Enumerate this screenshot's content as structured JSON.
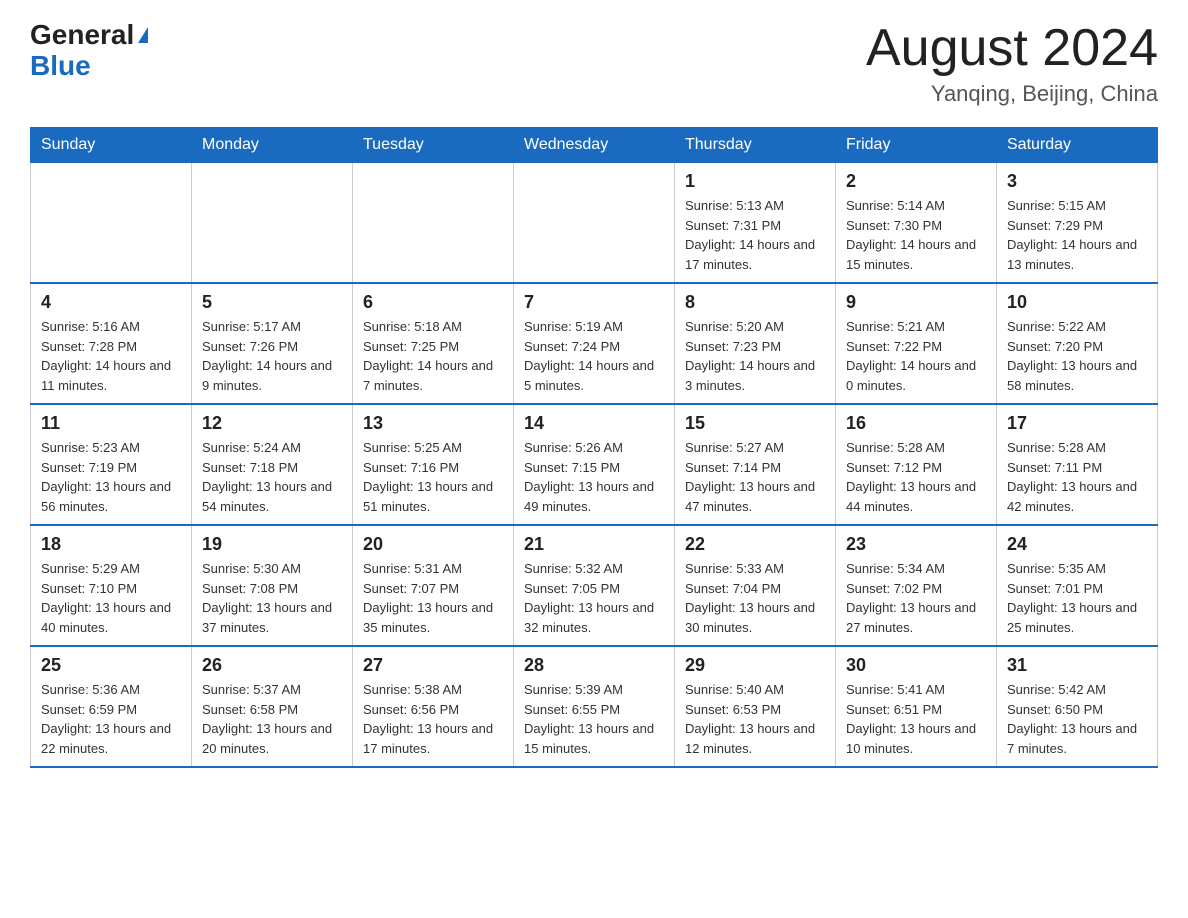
{
  "header": {
    "logo_general": "General",
    "logo_blue": "Blue",
    "title": "August 2024",
    "subtitle": "Yanqing, Beijing, China"
  },
  "weekdays": [
    "Sunday",
    "Monday",
    "Tuesday",
    "Wednesday",
    "Thursday",
    "Friday",
    "Saturday"
  ],
  "weeks": [
    [
      {
        "num": "",
        "info": ""
      },
      {
        "num": "",
        "info": ""
      },
      {
        "num": "",
        "info": ""
      },
      {
        "num": "",
        "info": ""
      },
      {
        "num": "1",
        "info": "Sunrise: 5:13 AM\nSunset: 7:31 PM\nDaylight: 14 hours and 17 minutes."
      },
      {
        "num": "2",
        "info": "Sunrise: 5:14 AM\nSunset: 7:30 PM\nDaylight: 14 hours and 15 minutes."
      },
      {
        "num": "3",
        "info": "Sunrise: 5:15 AM\nSunset: 7:29 PM\nDaylight: 14 hours and 13 minutes."
      }
    ],
    [
      {
        "num": "4",
        "info": "Sunrise: 5:16 AM\nSunset: 7:28 PM\nDaylight: 14 hours and 11 minutes."
      },
      {
        "num": "5",
        "info": "Sunrise: 5:17 AM\nSunset: 7:26 PM\nDaylight: 14 hours and 9 minutes."
      },
      {
        "num": "6",
        "info": "Sunrise: 5:18 AM\nSunset: 7:25 PM\nDaylight: 14 hours and 7 minutes."
      },
      {
        "num": "7",
        "info": "Sunrise: 5:19 AM\nSunset: 7:24 PM\nDaylight: 14 hours and 5 minutes."
      },
      {
        "num": "8",
        "info": "Sunrise: 5:20 AM\nSunset: 7:23 PM\nDaylight: 14 hours and 3 minutes."
      },
      {
        "num": "9",
        "info": "Sunrise: 5:21 AM\nSunset: 7:22 PM\nDaylight: 14 hours and 0 minutes."
      },
      {
        "num": "10",
        "info": "Sunrise: 5:22 AM\nSunset: 7:20 PM\nDaylight: 13 hours and 58 minutes."
      }
    ],
    [
      {
        "num": "11",
        "info": "Sunrise: 5:23 AM\nSunset: 7:19 PM\nDaylight: 13 hours and 56 minutes."
      },
      {
        "num": "12",
        "info": "Sunrise: 5:24 AM\nSunset: 7:18 PM\nDaylight: 13 hours and 54 minutes."
      },
      {
        "num": "13",
        "info": "Sunrise: 5:25 AM\nSunset: 7:16 PM\nDaylight: 13 hours and 51 minutes."
      },
      {
        "num": "14",
        "info": "Sunrise: 5:26 AM\nSunset: 7:15 PM\nDaylight: 13 hours and 49 minutes."
      },
      {
        "num": "15",
        "info": "Sunrise: 5:27 AM\nSunset: 7:14 PM\nDaylight: 13 hours and 47 minutes."
      },
      {
        "num": "16",
        "info": "Sunrise: 5:28 AM\nSunset: 7:12 PM\nDaylight: 13 hours and 44 minutes."
      },
      {
        "num": "17",
        "info": "Sunrise: 5:28 AM\nSunset: 7:11 PM\nDaylight: 13 hours and 42 minutes."
      }
    ],
    [
      {
        "num": "18",
        "info": "Sunrise: 5:29 AM\nSunset: 7:10 PM\nDaylight: 13 hours and 40 minutes."
      },
      {
        "num": "19",
        "info": "Sunrise: 5:30 AM\nSunset: 7:08 PM\nDaylight: 13 hours and 37 minutes."
      },
      {
        "num": "20",
        "info": "Sunrise: 5:31 AM\nSunset: 7:07 PM\nDaylight: 13 hours and 35 minutes."
      },
      {
        "num": "21",
        "info": "Sunrise: 5:32 AM\nSunset: 7:05 PM\nDaylight: 13 hours and 32 minutes."
      },
      {
        "num": "22",
        "info": "Sunrise: 5:33 AM\nSunset: 7:04 PM\nDaylight: 13 hours and 30 minutes."
      },
      {
        "num": "23",
        "info": "Sunrise: 5:34 AM\nSunset: 7:02 PM\nDaylight: 13 hours and 27 minutes."
      },
      {
        "num": "24",
        "info": "Sunrise: 5:35 AM\nSunset: 7:01 PM\nDaylight: 13 hours and 25 minutes."
      }
    ],
    [
      {
        "num": "25",
        "info": "Sunrise: 5:36 AM\nSunset: 6:59 PM\nDaylight: 13 hours and 22 minutes."
      },
      {
        "num": "26",
        "info": "Sunrise: 5:37 AM\nSunset: 6:58 PM\nDaylight: 13 hours and 20 minutes."
      },
      {
        "num": "27",
        "info": "Sunrise: 5:38 AM\nSunset: 6:56 PM\nDaylight: 13 hours and 17 minutes."
      },
      {
        "num": "28",
        "info": "Sunrise: 5:39 AM\nSunset: 6:55 PM\nDaylight: 13 hours and 15 minutes."
      },
      {
        "num": "29",
        "info": "Sunrise: 5:40 AM\nSunset: 6:53 PM\nDaylight: 13 hours and 12 minutes."
      },
      {
        "num": "30",
        "info": "Sunrise: 5:41 AM\nSunset: 6:51 PM\nDaylight: 13 hours and 10 minutes."
      },
      {
        "num": "31",
        "info": "Sunrise: 5:42 AM\nSunset: 6:50 PM\nDaylight: 13 hours and 7 minutes."
      }
    ]
  ]
}
